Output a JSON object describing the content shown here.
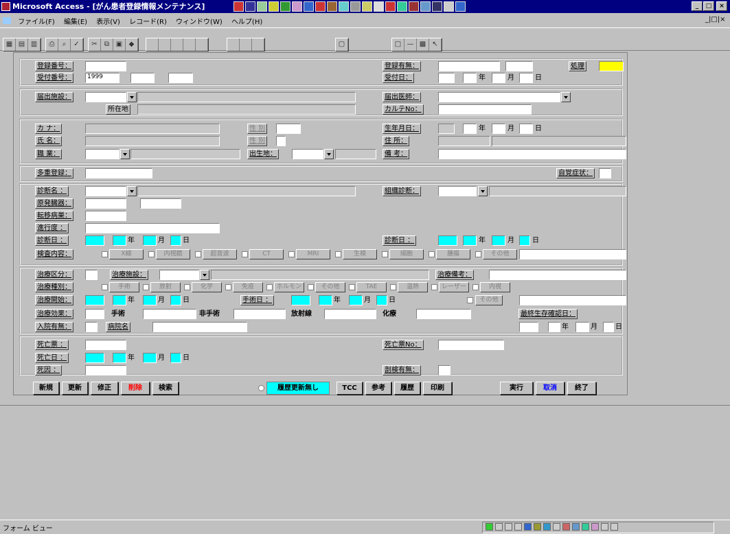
{
  "window": {
    "title": "Microsoft Access - [がん患者登録情報メンテナンス]",
    "menu": [
      "ファイル(F)",
      "編集(E)",
      "表示(V)",
      "レコード(R)",
      "ウィンドウ(W)",
      "ヘルプ(H)"
    ],
    "control_buttons": {
      "minimize": "_",
      "restore": "□",
      "close": "×"
    },
    "mdi_controls": "_|□|×"
  },
  "form": {
    "row1": {
      "reg_no_label": "登録番号：",
      "accept_no_label": "受付番号：",
      "accept_no_value": "1999",
      "reg_status_label": "登録有無：",
      "accept_date_label": "受付日：",
      "judge_label": "処理"
    },
    "row2": {
      "report_facility_label": "届出施設：",
      "location_label": "所在地",
      "diag_doctor_label": "届出医師：",
      "karte_label": "カルテNo："
    },
    "row3": {
      "kana_label": "カ ナ：",
      "name_label": "氏 名：",
      "sex_label": "性 別",
      "birth_label": "生年月日：",
      "address_label": "住 所：",
      "occupation_label": "職 業：",
      "birthplace_label": "出生地：",
      "note_label": "備 考："
    },
    "row4": {
      "multi_label": "多重登録：",
      "self_label": "自覚症状："
    },
    "row5": {
      "diag_name_label": "診断名 ：",
      "tissue_label": "組織診断：",
      "primary_label": "原発臓器：",
      "metastasis_label": "転移病巣：",
      "extent_label": "進行度 ：",
      "diag_date_label": "診断日 ：",
      "exam_date_label": "診断日 ：",
      "exam_content_label": "検査内容："
    },
    "row6": {
      "treatment_label": "治療区分：",
      "treat_facility_label": "治療施設：",
      "treat_note_label": "治療備考：",
      "treat_type_label": "治療種別：",
      "treat_start_label": "治療開始：",
      "surgery_date_label": "手術日 ：",
      "effect_label": "治療効果：",
      "radiation_label": "放射線",
      "chemo_label": "化療",
      "surgery_label": "手術",
      "nonsurgery_label": "非手術",
      "admission_label": "入院有無：",
      "hospital_label": "病院名",
      "survival_confirm_label": "最終生存確認日："
    },
    "row7": {
      "death_label": "死亡票 ：",
      "death_date_label": "死亡日 ：",
      "death_no_label": "死亡票No：",
      "cause_label": "死因 ：",
      "autopsy_label": "剖検有無："
    },
    "date_units": {
      "year": "年",
      "month": "月",
      "day": "日"
    },
    "exam_buttons": [
      "X線",
      "内視鏡",
      "超音波",
      "CT",
      "MRI",
      "生検",
      "細胞",
      "腫瘍",
      "その他"
    ],
    "treat_buttons": [
      "手術",
      "放射",
      "化学",
      "免疫",
      "ホルモン",
      "その他",
      "TAE",
      "温熱",
      "レーザー",
      "内視"
    ],
    "other_button": "その他",
    "option_label": "履歴更新無し",
    "buttons": [
      "新規",
      "更新",
      "修正",
      "削除",
      "検索",
      "TCC",
      "参考",
      "履歴",
      "印刷",
      "実行",
      "取消",
      "終了"
    ],
    "button_colors": {
      "delete": "#ff0000",
      "cancel": "#0000ff",
      "yellow": "#ffff00",
      "cyan": "#00ffff"
    }
  },
  "status": {
    "view_mode": "フォーム ビュー"
  }
}
